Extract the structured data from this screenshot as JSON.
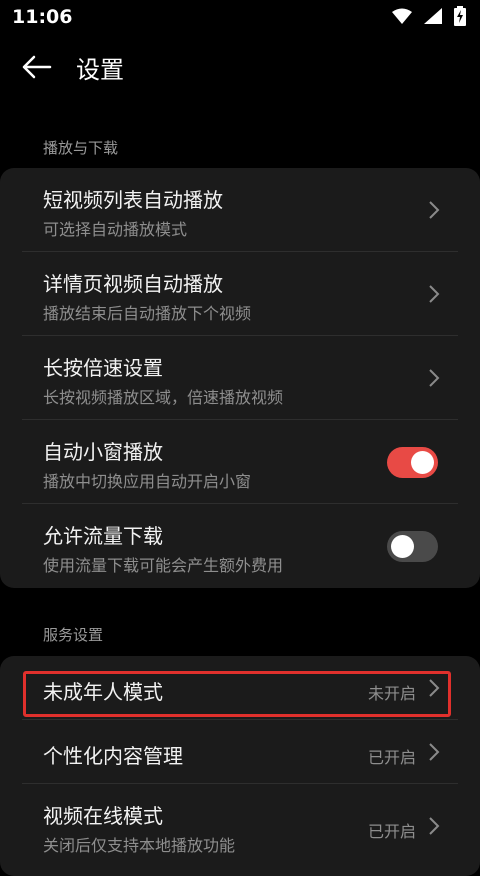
{
  "status": {
    "time": "11:06"
  },
  "header": {
    "title": "设置"
  },
  "sections": {
    "playback": {
      "label": "播放与下载",
      "items": [
        {
          "title": "短视频列表自动播放",
          "subtitle": "可选择自动播放模式"
        },
        {
          "title": "详情页视频自动播放",
          "subtitle": "播放结束后自动播放下个视频"
        },
        {
          "title": "长按倍速设置",
          "subtitle": "长按视频播放区域，倍速播放视频"
        },
        {
          "title": "自动小窗播放",
          "subtitle": "播放中切换应用自动开启小窗",
          "toggle": "on"
        },
        {
          "title": "允许流量下载",
          "subtitle": "使用流量下载可能会产生额外费用",
          "toggle": "off"
        }
      ]
    },
    "service": {
      "label": "服务设置",
      "items": [
        {
          "title": "未成年人模式",
          "value": "未开启"
        },
        {
          "title": "个性化内容管理",
          "value": "已开启"
        },
        {
          "title": "视频在线模式",
          "subtitle": "关闭后仅支持本地播放功能",
          "value": "已开启"
        }
      ]
    }
  },
  "colors": {
    "accent": "#e84a45",
    "highlight": "#e0302c",
    "card": "#1b1b1b"
  }
}
